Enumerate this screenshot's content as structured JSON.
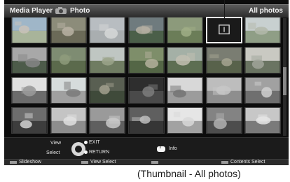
{
  "header": {
    "app_title": "Media Player",
    "section": "Photo",
    "filter_label": "All photos"
  },
  "bottom": {
    "view_label": "View",
    "select_label": "Select",
    "exit_label": "EXIT",
    "return_label": "RETURN",
    "info_label": "Info",
    "info_button_glyph": "i"
  },
  "colorbar": [
    {
      "label": "Slideshow",
      "color": "#9a9a9a"
    },
    {
      "label": "View Select",
      "color": "#9a9a9a"
    },
    {
      "label": "",
      "color": "#9a9a9a"
    },
    {
      "label": "Contents Select",
      "color": "#9a9a9a"
    }
  ],
  "caption": "(Thumbnail - All photos)",
  "thumbnails": [
    {
      "name": "thumb-1",
      "sky": "#9fb6c8",
      "ground": "#a8b49a",
      "subject": "#c9c2b8"
    },
    {
      "name": "thumb-2",
      "sky": "#8c8c7a",
      "ground": "#6b6a58",
      "subject": "#b8b2a3"
    },
    {
      "name": "thumb-3",
      "sky": "#b8bdc1",
      "ground": "#a9aeb0",
      "subject": "#d6d8d8"
    },
    {
      "name": "thumb-4",
      "sky": "#6f7b7e",
      "ground": "#4b5f49",
      "subject": "#b7b1a3"
    },
    {
      "name": "thumb-5",
      "sky": "#8c9a7b",
      "ground": "#6b7d58",
      "subject": "#9fae86"
    },
    {
      "name": "thumb-6",
      "sky": "#1a1a1a",
      "ground": "#1a1a1a",
      "subject": "#dcdcdc"
    },
    {
      "name": "thumb-7",
      "sky": "#c8d0d0",
      "ground": "#8f9e86",
      "subject": "#b3b8aa"
    },
    {
      "name": "thumb-8",
      "sky": "#a8a8a8",
      "ground": "#4d5b4a",
      "subject": "#868686"
    },
    {
      "name": "thumb-9",
      "sky": "#7e8c72",
      "ground": "#5b6a4c",
      "subject": "#8e9b7b"
    },
    {
      "name": "thumb-10",
      "sky": "#bfc6c2",
      "ground": "#6f7c62",
      "subject": "#9ba48b"
    },
    {
      "name": "thumb-11",
      "sky": "#7e8e6a",
      "ground": "#546646",
      "subject": "#b4b09c"
    },
    {
      "name": "thumb-12",
      "sky": "#a4b0a6",
      "ground": "#5d6e52",
      "subject": "#c2c0b2"
    },
    {
      "name": "thumb-13",
      "sky": "#7a7d72",
      "ground": "#58624b",
      "subject": "#a6a591"
    },
    {
      "name": "thumb-14",
      "sky": "#c9c9c2",
      "ground": "#6a7462",
      "subject": "#a0a59a"
    },
    {
      "name": "thumb-15",
      "sky": "#e0e0e0",
      "ground": "#6c6c6c",
      "subject": "#9a9a9a"
    },
    {
      "name": "thumb-16",
      "sky": "#d6dcdc",
      "ground": "#a0a0a0",
      "subject": "#7a7a7a"
    },
    {
      "name": "thumb-17",
      "sky": "#595f52",
      "ground": "#3f4a3a",
      "subject": "#a2a08e"
    },
    {
      "name": "thumb-18",
      "sky": "#2e2e2e",
      "ground": "#4a4a4a",
      "subject": "#7c7c7c"
    },
    {
      "name": "thumb-19",
      "sky": "#d8d8d8",
      "ground": "#9c9c9c",
      "subject": "#747474"
    },
    {
      "name": "thumb-20",
      "sky": "#bdbdbd",
      "ground": "#8e8e8e",
      "subject": "#c7c7c7"
    },
    {
      "name": "thumb-21",
      "sky": "#a1a1a1",
      "ground": "#6f6f6f",
      "subject": "#d0d0d0"
    },
    {
      "name": "thumb-22",
      "sky": "#6d6d6d",
      "ground": "#3d3d3d",
      "subject": "#d4d4d4"
    },
    {
      "name": "thumb-23",
      "sky": "#c4c4c4",
      "ground": "#8d8d8d",
      "subject": "#e0e0e0"
    },
    {
      "name": "thumb-24",
      "sky": "#9a9a9a",
      "ground": "#5f5f5f",
      "subject": "#c9c9c9"
    },
    {
      "name": "thumb-25",
      "sky": "#5f5f5f",
      "ground": "#363636",
      "subject": "#bdbdbd"
    },
    {
      "name": "thumb-26",
      "sky": "#e6e6e6",
      "ground": "#a2a2a2",
      "subject": "#d8d8d8"
    },
    {
      "name": "thumb-27",
      "sky": "#838383",
      "ground": "#4d4d4d",
      "subject": "#b1b1b1"
    },
    {
      "name": "thumb-28",
      "sky": "#c7c7c7",
      "ground": "#7a7a7a",
      "subject": "#e5e5e5"
    }
  ]
}
